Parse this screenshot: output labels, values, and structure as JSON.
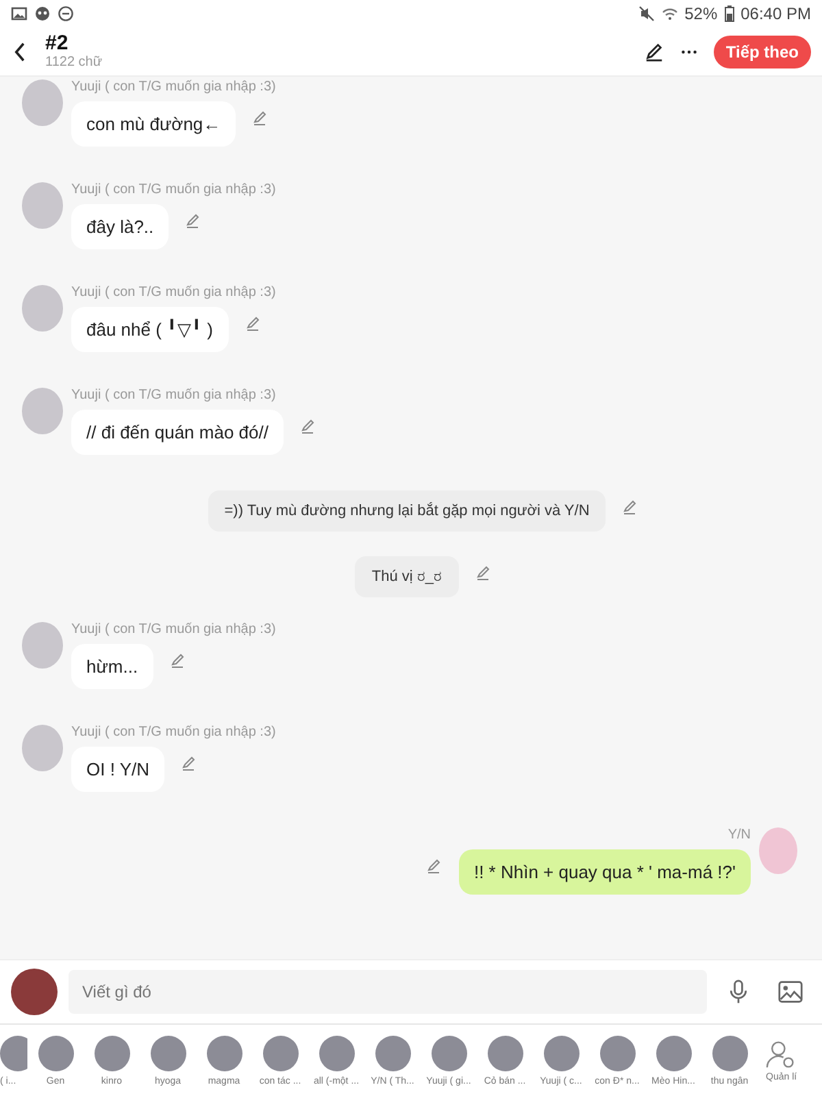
{
  "status_bar": {
    "battery": "52%",
    "time": "06:40 PM"
  },
  "header": {
    "title": "#2",
    "subtitle": "1122 chữ",
    "next_button": "Tiếp theo"
  },
  "messages": [
    {
      "kind": "left",
      "name": "Yuuji ( con T/G muốn gia nhập :3)",
      "text": "con mù đường←"
    },
    {
      "kind": "left",
      "name": "Yuuji ( con T/G muốn gia nhập :3)",
      "text": "đây là?.."
    },
    {
      "kind": "left",
      "name": "Yuuji ( con T/G muốn gia nhập :3)",
      "text": "đâu nhể ( ╹▽╹ )"
    },
    {
      "kind": "left",
      "name": "Yuuji ( con T/G muốn gia nhập :3)",
      "text": "// đi đến quán mào đó//"
    },
    {
      "kind": "narration",
      "text": "=)) Tuy mù đường nhưng lại bắt gặp mọi người và Y/N"
    },
    {
      "kind": "narration",
      "text": "Thú vị ರ_ರ"
    },
    {
      "kind": "left",
      "name": "Yuuji ( con T/G muốn gia nhập :3)",
      "text": "hừm..."
    },
    {
      "kind": "left",
      "name": "Yuuji ( con T/G muốn gia nhập :3)",
      "text": "OI ! Y/N"
    },
    {
      "kind": "right",
      "name": "Y/N",
      "text": "!! * Nhìn + quay qua * ' ma-má !?'"
    }
  ],
  "composer": {
    "placeholder": "Viết gì đó"
  },
  "characters": [
    {
      "name": "( i..."
    },
    {
      "name": "Gen"
    },
    {
      "name": "kinro"
    },
    {
      "name": "hyoga"
    },
    {
      "name": "magma"
    },
    {
      "name": "con tác ..."
    },
    {
      "name": "all (-một ..."
    },
    {
      "name": "Y/N ( Th..."
    },
    {
      "name": "Yuuji ( gi..."
    },
    {
      "name": "Cỏ bán ..."
    },
    {
      "name": "Yuuji ( c..."
    },
    {
      "name": "con Đ* n..."
    },
    {
      "name": "Mèo Hin..."
    },
    {
      "name": "thu ngân"
    }
  ],
  "manage_button": "Quản lí"
}
